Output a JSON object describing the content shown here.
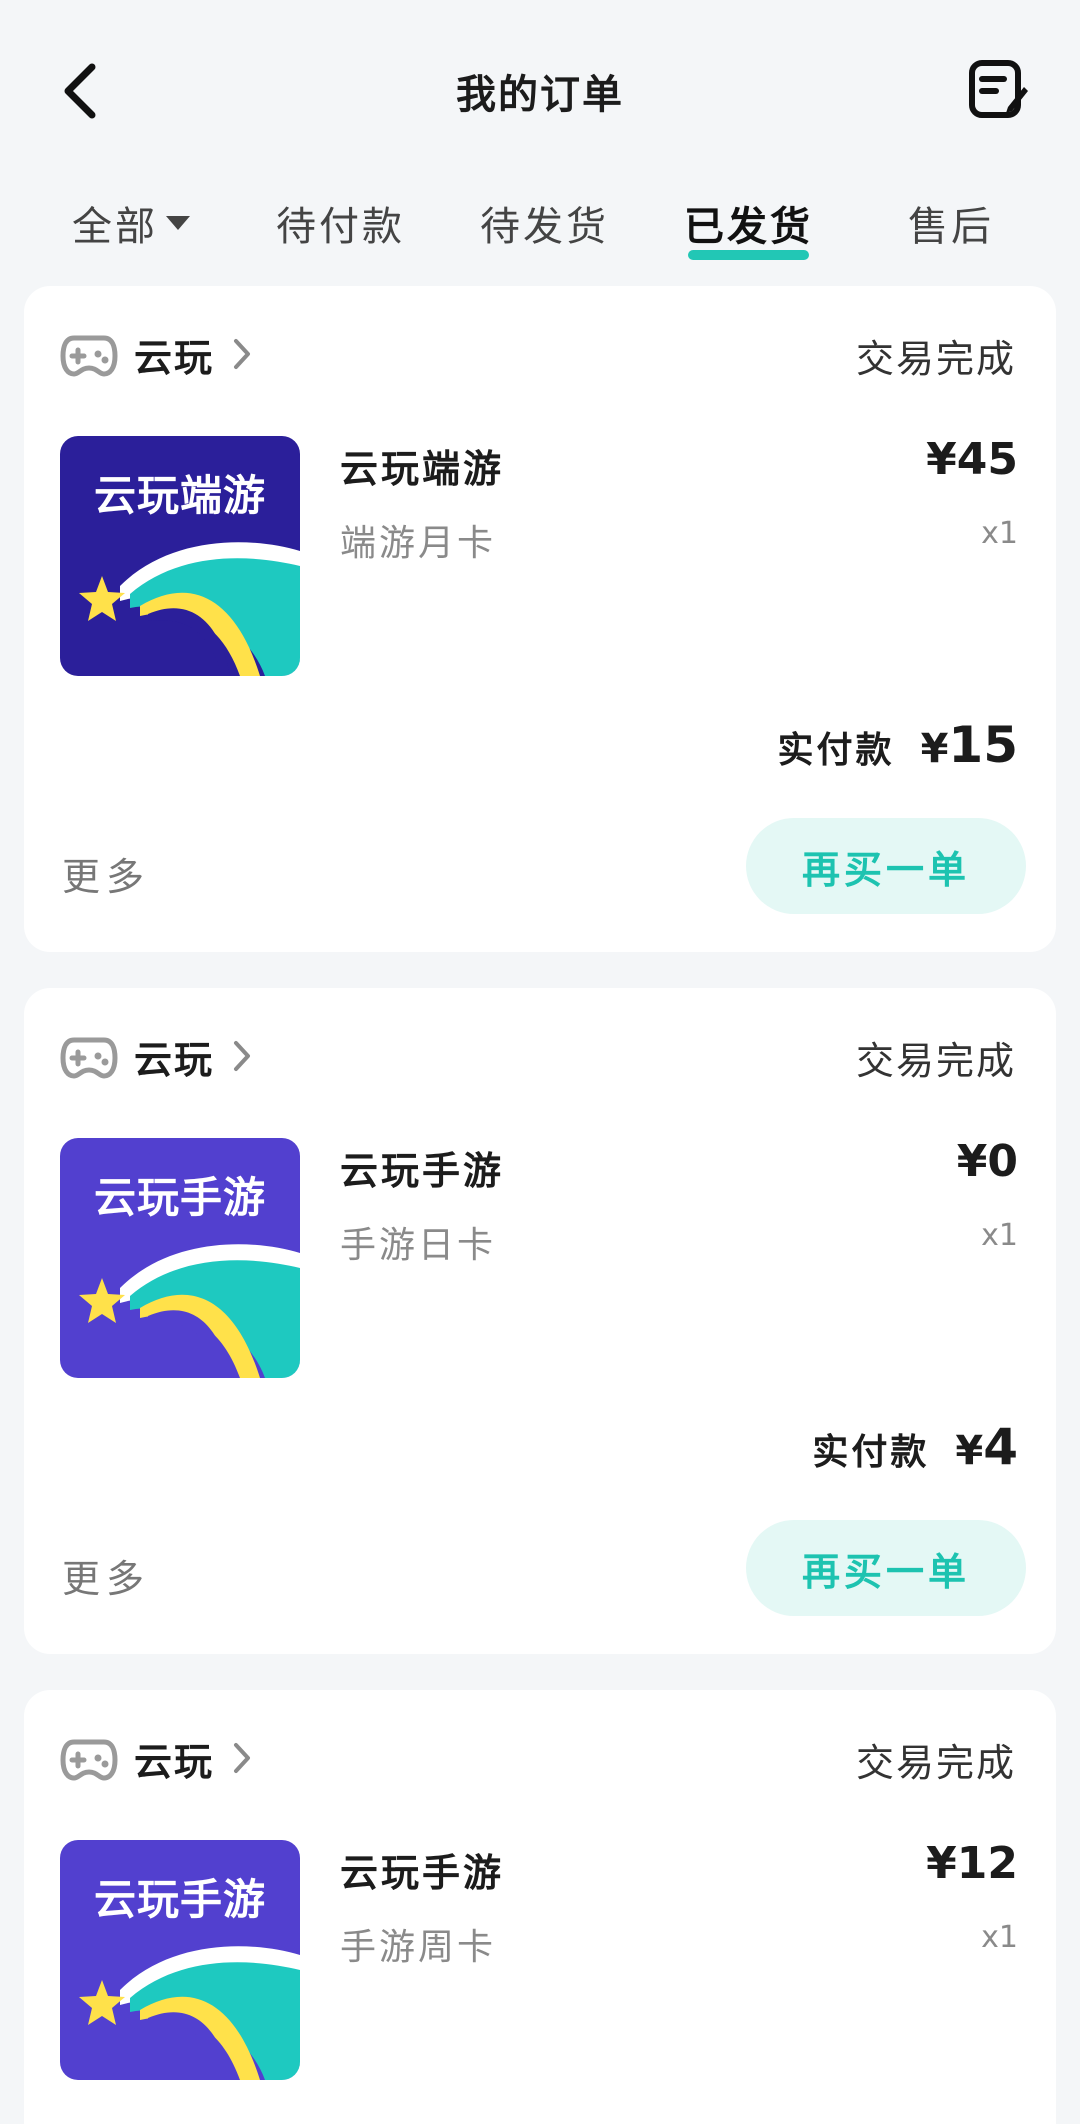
{
  "header": {
    "title": "我的订单",
    "back_icon": "chevron-left-icon",
    "edit_icon": "edit-note-icon"
  },
  "tabs": [
    {
      "label": "全部",
      "active": false,
      "has_dropdown": true
    },
    {
      "label": "待付款",
      "active": false
    },
    {
      "label": "待发货",
      "active": false
    },
    {
      "label": "已发货",
      "active": true
    },
    {
      "label": "售后",
      "active": false
    }
  ],
  "accent_color": "#22c7b5",
  "orders": [
    {
      "shop": "云玩",
      "status": "交易完成",
      "thumb_text": "云玩端游",
      "thumb_color": "#2b1f9a",
      "product_name": "云玩端游",
      "product_sub": "端游月卡",
      "price": "¥45",
      "qty": "x1",
      "paid_label": "实付款",
      "paid_currency": "¥",
      "paid_amount": "15",
      "more_label": "更多",
      "rebuy_label": "再买一单"
    },
    {
      "shop": "云玩",
      "status": "交易完成",
      "thumb_text": "云玩手游",
      "thumb_color": "#5240cf",
      "product_name": "云玩手游",
      "product_sub": "手游日卡",
      "price": "¥0",
      "qty": "x1",
      "paid_label": "实付款",
      "paid_currency": "¥",
      "paid_amount": "4",
      "more_label": "更多",
      "rebuy_label": "再买一单"
    },
    {
      "shop": "云玩",
      "status": "交易完成",
      "thumb_text": "云玩手游",
      "thumb_color": "#5240cf",
      "product_name": "云玩手游",
      "product_sub": "手游周卡",
      "price": "¥12",
      "qty": "x1"
    }
  ]
}
